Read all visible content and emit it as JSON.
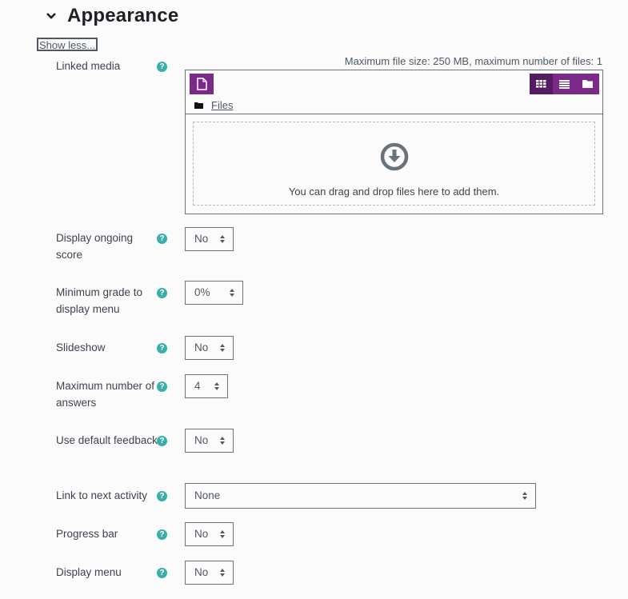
{
  "section": {
    "title": "Appearance",
    "toggle_icon": "chevron-down-icon",
    "show_less_label": "Show less..."
  },
  "colors": {
    "accent_purple": "#7b2a8a",
    "accent_purple_active": "#531d5f",
    "help_teal": "#3aaea8",
    "text_dark": "#1d2125",
    "text_muted": "#4e5964"
  },
  "linked_media": {
    "label": "Linked media",
    "help_icon": "question-circle-icon",
    "file_limits": "Maximum file size: 250 MB, maximum number of files: 1",
    "add_file_icon": "file-add-icon",
    "view_icons": [
      "grid-view-icon",
      "list-view-icon",
      "folder-tree-view-icon"
    ],
    "path_folder_icon": "folder-icon",
    "path_label": "Files",
    "drop_icon": "download-circle-icon",
    "drop_text": "You can drag and drop files here to add them."
  },
  "fields": [
    {
      "label": "Display ongoing score",
      "value": "No"
    },
    {
      "label": "Minimum grade to display menu",
      "value": "0%"
    },
    {
      "label": "Slideshow",
      "value": "No"
    },
    {
      "label": "Maximum number of answers",
      "value": "4"
    },
    {
      "label": "Use default feedback",
      "value": "No"
    },
    {
      "label": "Link to next activity",
      "value": "None"
    },
    {
      "label": "Progress bar",
      "value": "No"
    },
    {
      "label": "Display menu",
      "value": "No"
    }
  ],
  "help_glyph": "?"
}
